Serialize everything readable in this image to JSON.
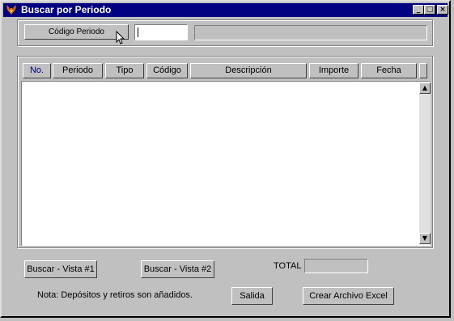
{
  "window": {
    "title": "Buscar por Periodo",
    "controls": {
      "minimize": "_",
      "maximize": "□",
      "close": "×"
    }
  },
  "search": {
    "button_label": "Código Periodo",
    "code_value": "",
    "description_value": ""
  },
  "table": {
    "columns": [
      "No.",
      "Periodo",
      "Tipo",
      "Código",
      "Descripción",
      "Importe",
      "Fecha"
    ],
    "rows": []
  },
  "footer": {
    "buscar_vista1": "Buscar - Vista #1",
    "buscar_vista2": "Buscar - Vista #2",
    "total_label": "TOTAL",
    "total_value": "",
    "nota": "Nota: Depósitos y retiros son añadidos.",
    "salida": "Salida",
    "crear_excel": "Crear Archivo Excel"
  },
  "colors": {
    "titlebar": "#000080",
    "face": "#c0c0c0",
    "header_first": "#000080"
  }
}
